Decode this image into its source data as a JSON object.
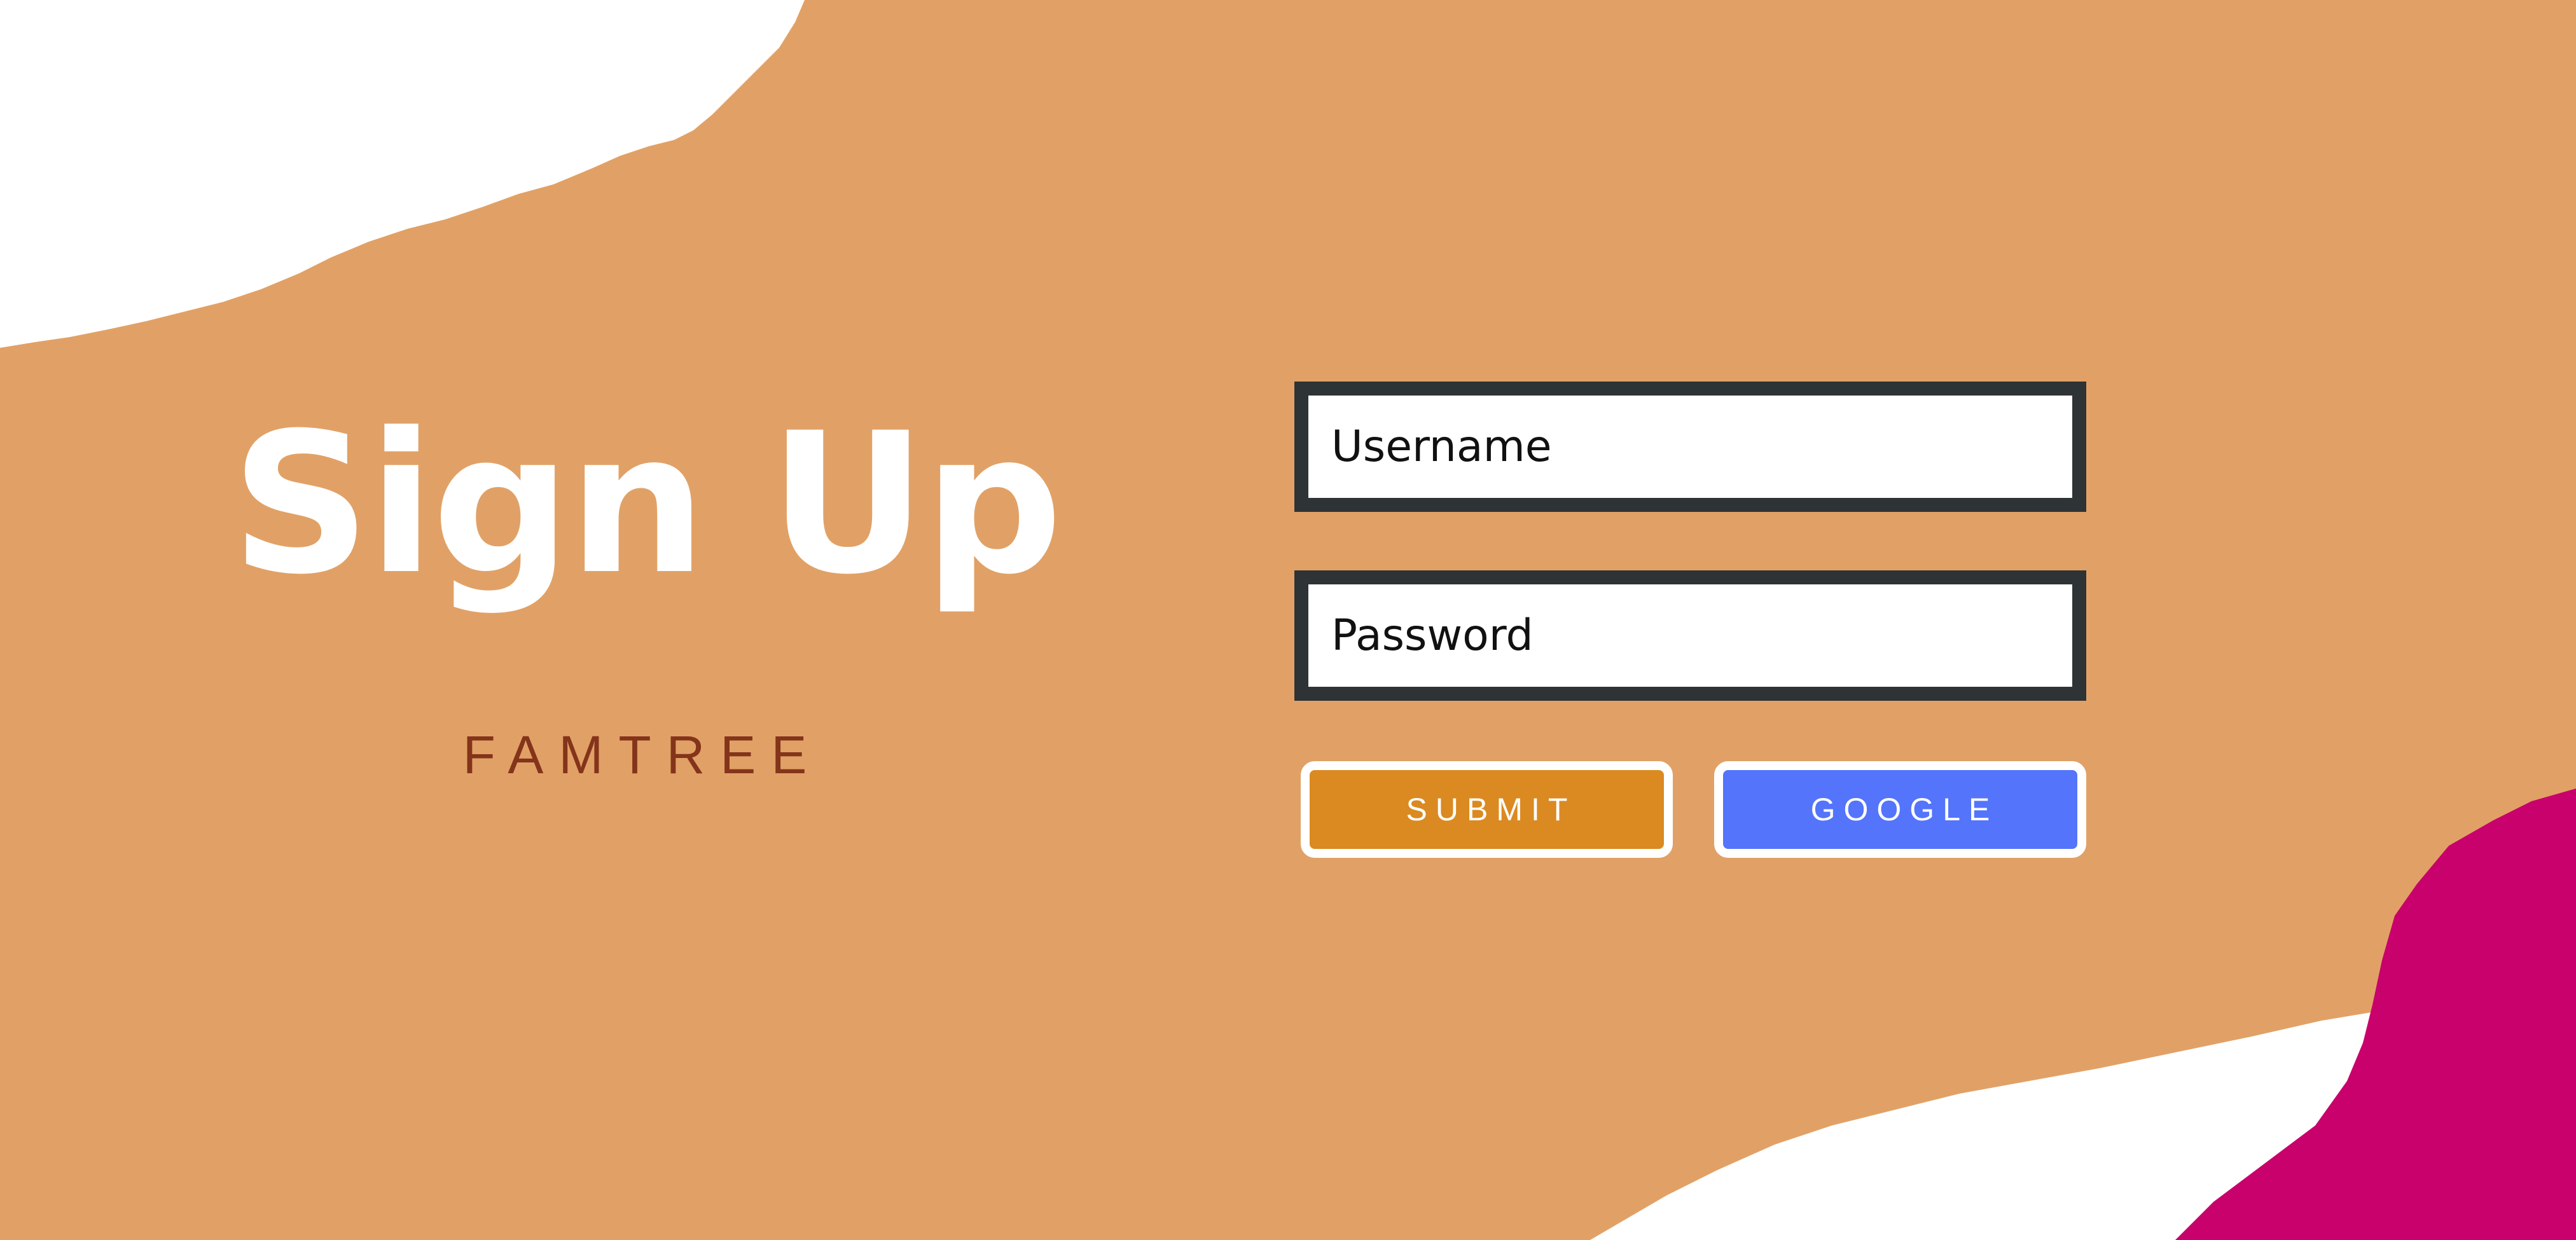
{
  "page": {
    "title": "Sign Up",
    "subtitle": "FAMTREE"
  },
  "form": {
    "username_placeholder": "Username",
    "username_value": "",
    "password_placeholder": "Password",
    "password_value": "",
    "submit_label": "SUBMIT",
    "google_label": "GOOGLE"
  },
  "colors": {
    "background": "#e1a166",
    "title": "#ffffff",
    "subtitle": "#84341a",
    "field_border": "#2e3336",
    "submit_button": "#db8a21",
    "google_button": "#5474fb",
    "accent_shape": "#c8016c",
    "paper_shape": "#ffffff"
  }
}
